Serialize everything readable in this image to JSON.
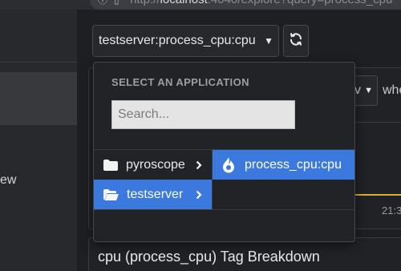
{
  "browser": {
    "url_scheme": "http://",
    "url_host": "localhost",
    "url_rest": ":4040/explore?query=process_cpu"
  },
  "sidebar": {
    "partial_label": "ew"
  },
  "header": {
    "app_selector_label": "testserver:process_cpu:cpu",
    "app_selector_caret": "▼",
    "refresh_icon": "refresh-icon"
  },
  "background": {
    "view_select_value": "v",
    "view_select_caret": "▼",
    "where_text": "whe",
    "time_tick": "21:3",
    "breakdown_title": "cpu (process_cpu) Tag Breakdown",
    "chart_line_color": "#d8b12e"
  },
  "dropdown": {
    "header": "SELECT AN APPLICATION",
    "search_placeholder": "Search...",
    "groups": [
      {
        "label": "pyroscope",
        "icon": "folder-icon",
        "selected": false
      },
      {
        "label": "testserver",
        "icon": "folder-open-icon",
        "selected": true
      }
    ],
    "apps": [
      {
        "label": "process_cpu:cpu",
        "icon": "pyroscope-flame-icon",
        "selected": true
      }
    ],
    "selected_color": "#3b79df"
  }
}
